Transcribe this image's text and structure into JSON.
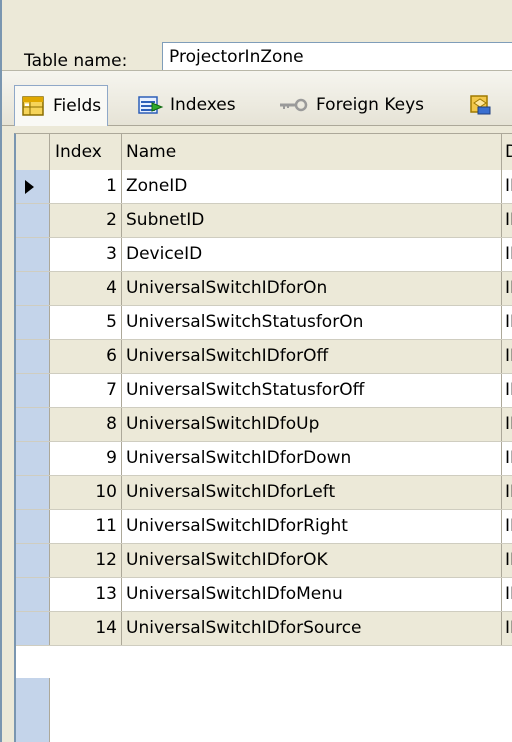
{
  "window": {
    "table_name_label": "Table name:",
    "table_name_value": "ProjectorInZone"
  },
  "tabs": [
    {
      "label": "Fields",
      "icon": "grid-table-icon",
      "selected": true
    },
    {
      "label": "Indexes",
      "icon": "index-arrow-icon",
      "selected": false
    },
    {
      "label": "Foreign Keys",
      "icon": "key-icon",
      "selected": false
    },
    {
      "label": "",
      "icon": "triggers-icon",
      "selected": false
    }
  ],
  "grid": {
    "columns": [
      "Index",
      "Name",
      "D"
    ],
    "rows": [
      {
        "index": "1",
        "name": "ZoneID",
        "type": "II",
        "current": true
      },
      {
        "index": "2",
        "name": "SubnetID",
        "type": "II"
      },
      {
        "index": "3",
        "name": "DeviceID",
        "type": "II"
      },
      {
        "index": "4",
        "name": "UniversalSwitchIDforOn",
        "type": "II"
      },
      {
        "index": "5",
        "name": "UniversalSwitchStatusforOn",
        "type": "II"
      },
      {
        "index": "6",
        "name": "UniversalSwitchIDforOff",
        "type": "II"
      },
      {
        "index": "7",
        "name": "UniversalSwitchStatusforOff",
        "type": "II"
      },
      {
        "index": "8",
        "name": "UniversalSwitchIDfoUp",
        "type": "II"
      },
      {
        "index": "9",
        "name": "UniversalSwitchIDforDown",
        "type": "II"
      },
      {
        "index": "10",
        "name": "UniversalSwitchIDforLeft",
        "type": "II"
      },
      {
        "index": "11",
        "name": "UniversalSwitchIDforRight",
        "type": "II"
      },
      {
        "index": "12",
        "name": "UniversalSwitchIDforOK",
        "type": "II"
      },
      {
        "index": "13",
        "name": "UniversalSwitchIDfoMenu",
        "type": "II"
      },
      {
        "index": "14",
        "name": "UniversalSwitchIDforSource",
        "type": "II"
      }
    ]
  },
  "colors": {
    "frame": "#ece9d8",
    "selector": "#c4d4ea",
    "border": "#aca899",
    "accent": "#7a96b0"
  }
}
